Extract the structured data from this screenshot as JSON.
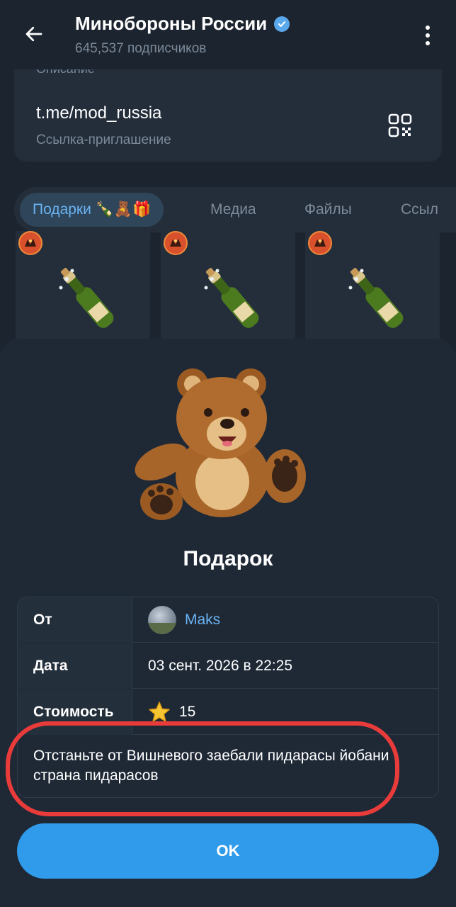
{
  "header": {
    "title": "Минобороны России",
    "subscribers": "645,537 подписчиков",
    "back_icon": "arrow-left-icon",
    "verified_icon": "verified-badge-icon",
    "menu_icon": "more-vertical-icon"
  },
  "info": {
    "description_label": "Описание",
    "link": "t.me/mod_russia",
    "link_sublabel": "Ссылка-приглашение",
    "qr_icon": "qr-code-icon"
  },
  "tabs": [
    {
      "label": "Подарки 🍾🧸🎁",
      "active": true
    },
    {
      "label": "Медиа",
      "active": false
    },
    {
      "label": "Файлы",
      "active": false
    },
    {
      "label": "Ссыл",
      "active": false
    }
  ],
  "gift_grid": {
    "item_icon": "champagne-bottle-icon",
    "badge_icon": "channel-avatar-icon"
  },
  "gift_sheet": {
    "gift_icon": "teddy-bear-icon",
    "title": "Подарок",
    "rows": {
      "from_label": "От",
      "from_value": "Maks",
      "date_label": "Дата",
      "date_value": "03 сент. 2026 в 22:25",
      "cost_label": "Стоимость",
      "cost_value": "15",
      "cost_icon": "star-icon"
    },
    "message": "Отстаньте от Вишневого заебали пидарасы йобани страна пидарасов",
    "ok_label": "OK"
  },
  "colors": {
    "background": "#1c242f",
    "card": "#242e3b",
    "accent": "#6ab3f3",
    "button": "#2f9bea",
    "annotation": "#ea3b3b"
  }
}
